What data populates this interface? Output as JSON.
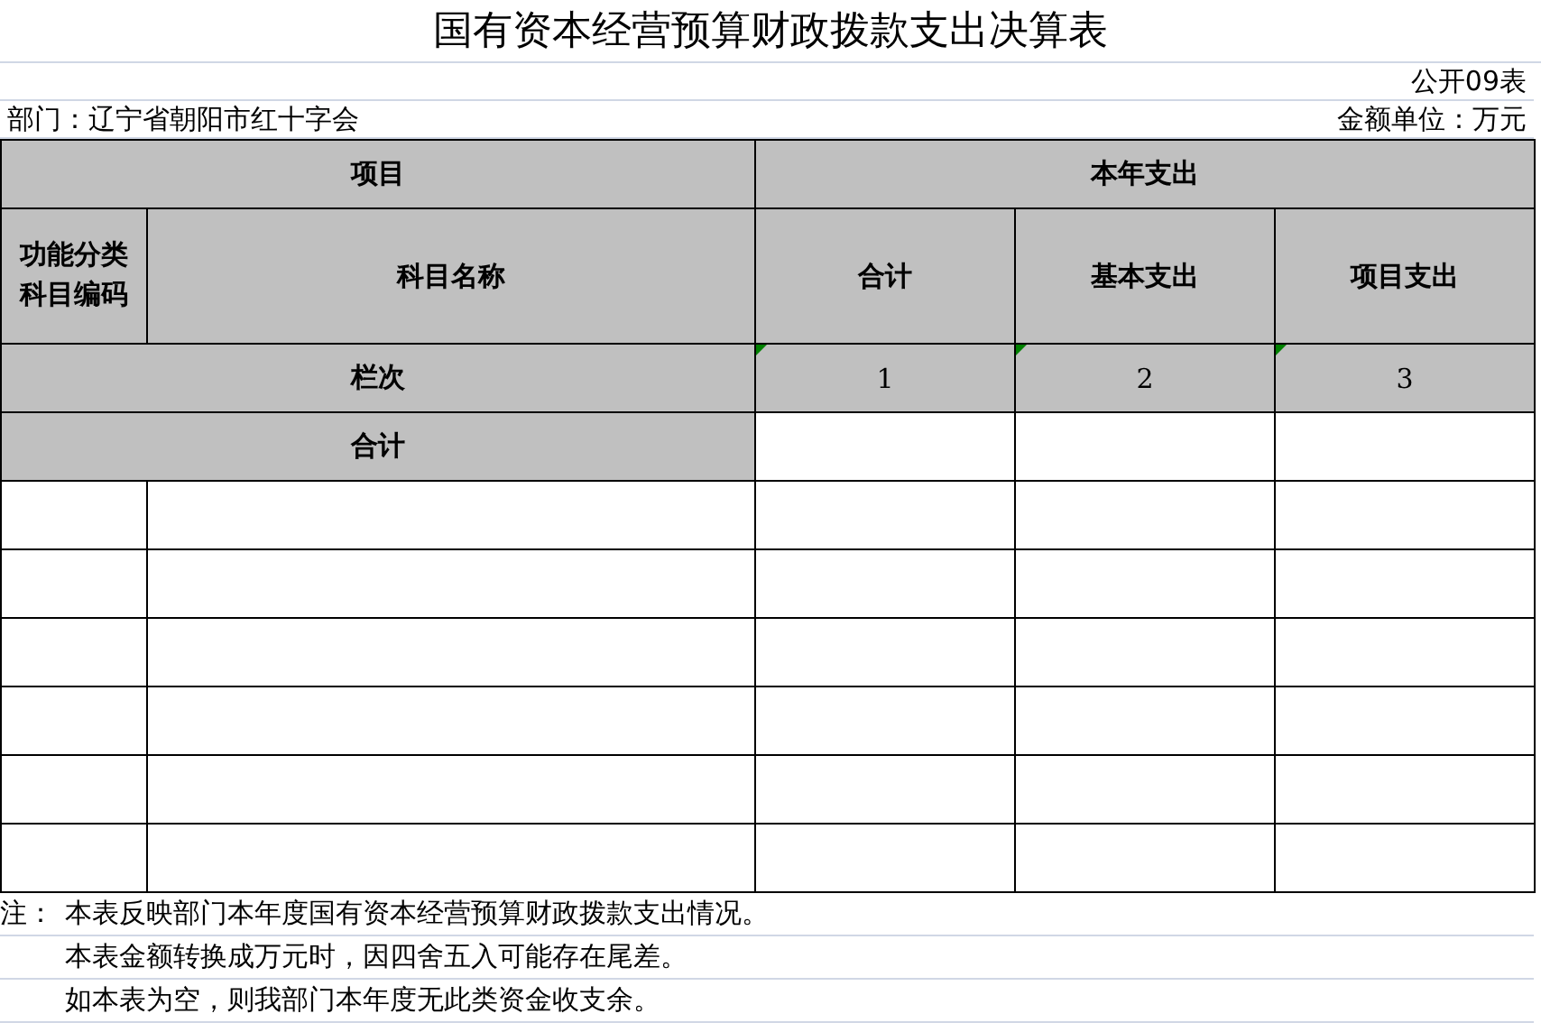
{
  "title": "国有资本经营预算财政拨款支出决算表",
  "form_code": "公开09表",
  "department": "部门：辽宁省朝阳市红十字会",
  "unit": "金额单位：万元",
  "table": {
    "group_headers": [
      "项目",
      "本年支出"
    ],
    "columns": [
      "功能分类科目编码",
      "科目名称",
      "合计",
      "基本支出",
      "项目支出"
    ],
    "index_row": {
      "label": "栏次",
      "values": [
        "1",
        "2",
        "3"
      ]
    },
    "total_row": {
      "label": "合计"
    }
  },
  "notes": {
    "prefix": "注：",
    "lines": [
      "本表反映部门本年度国有资本经营预算财政拨款支出情况。",
      "本表金额转换成万元时，因四舍五入可能存在尾差。",
      "如本表为空，则我部门本年度无此类资金收支余。"
    ]
  }
}
